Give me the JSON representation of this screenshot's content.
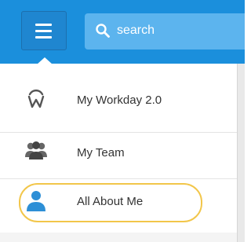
{
  "colors": {
    "header_bg": "#1b8fdc",
    "search_bg": "#5cb4ee",
    "highlight_ring": "#f2c64a",
    "icon_blue": "#2d8fd6"
  },
  "header": {
    "menu_icon": "hamburger-menu-icon",
    "search": {
      "icon": "search-icon",
      "placeholder": "search"
    }
  },
  "menu": {
    "items": [
      {
        "label": "My Workday 2.0",
        "icon": "workday-logo-icon"
      },
      {
        "label": "My Team",
        "icon": "team-people-icon"
      },
      {
        "label": "All About Me",
        "icon": "person-icon",
        "highlighted": true
      }
    ]
  }
}
